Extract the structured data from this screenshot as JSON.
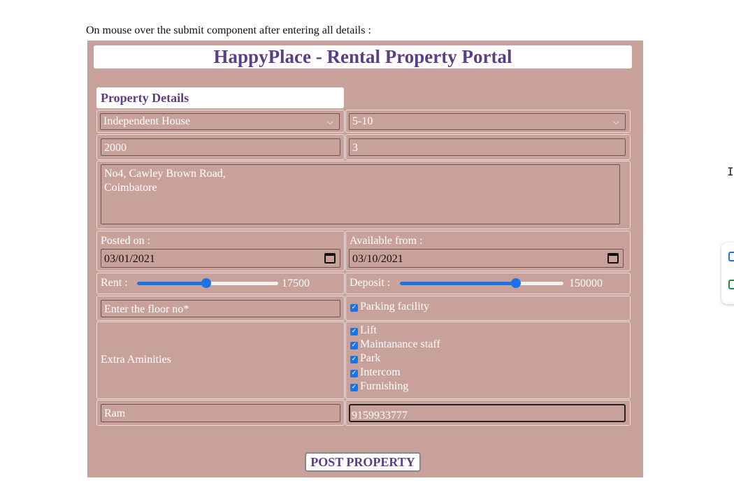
{
  "caption": "On mouse over the submit component after entering all details :",
  "form": {
    "title": "HappyPlace - Rental Property Portal",
    "section_heading": "Property Details",
    "property_type": "Independent House",
    "property_age": "5-10",
    "area": "2000",
    "bedrooms": "3",
    "address_line1": "No4, Cawley Brown Road,",
    "address_line2": "Coimbatore",
    "posted_on_label": "Posted on :",
    "posted_on_value": "03/01/2021",
    "available_from_label": "Available from :",
    "available_from_value": "03/10/2021",
    "rent_label": "Rent :",
    "rent_value": "17500",
    "rent_fraction": 0.49,
    "deposit_label": "Deposit :",
    "deposit_value": "150000",
    "deposit_fraction": 0.71,
    "floor_placeholder": "Enter the floor no*",
    "parking_label": "Parking facility",
    "amenities_label": "Extra Aminities",
    "amenities": [
      "Lift",
      "Maintanance staff",
      "Park",
      "Intercom",
      "Furnishing"
    ],
    "owner_name": "Ram",
    "phone": "9159933777",
    "submit_label": "POST PROPERTY"
  },
  "colors": {
    "form_bg": "#c9a19b",
    "title_text": "#5a3f86",
    "accent": "#1a73e8"
  },
  "icons": [
    "chevron-down-icon",
    "calendar-icon",
    "checkbox-checked-icon",
    "text-cursor-icon"
  ]
}
